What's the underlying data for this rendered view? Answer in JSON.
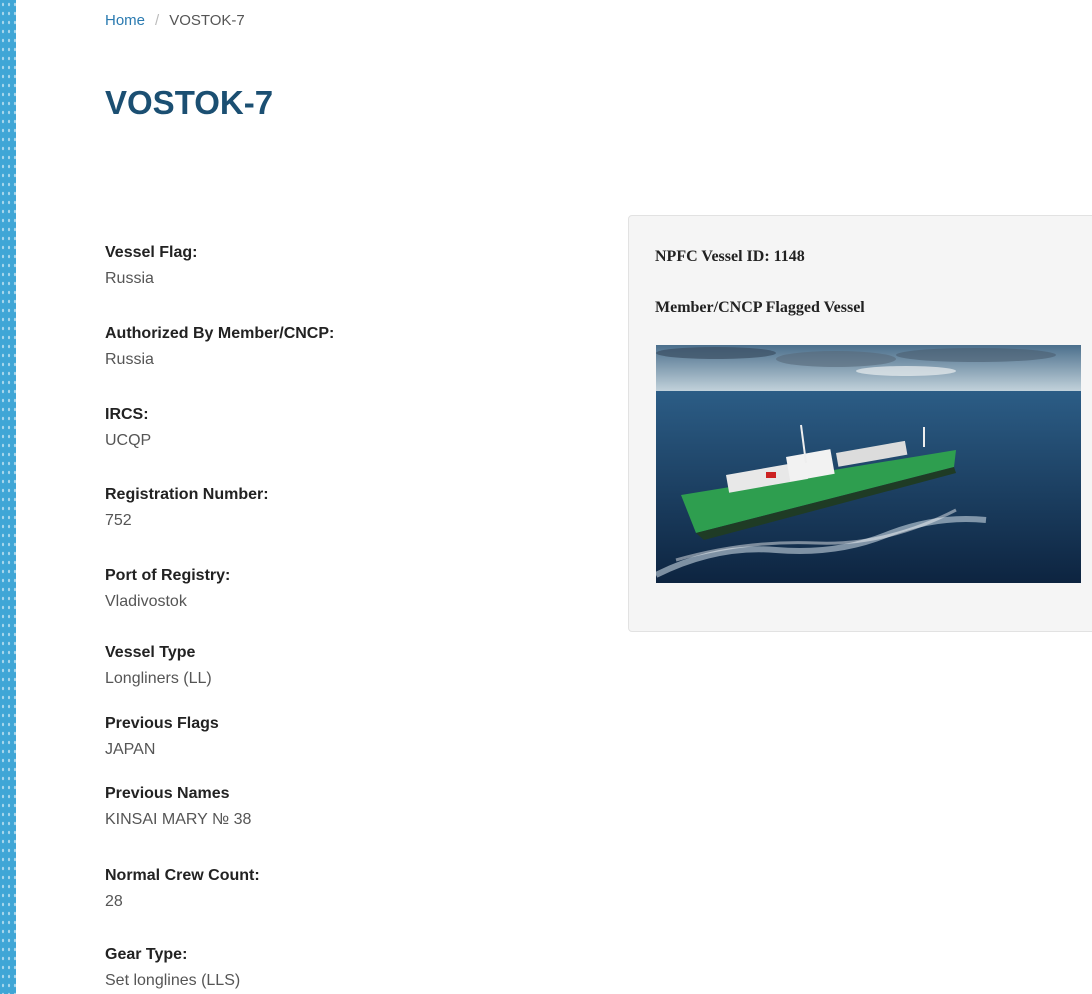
{
  "breadcrumb": {
    "home": "Home",
    "separator": "/",
    "current": "VOSTOK-7"
  },
  "page": {
    "title": "VOSTOK-7"
  },
  "fields": [
    {
      "label": "Vessel Flag:",
      "value": "Russia"
    },
    {
      "label": "Authorized By Member/CNCP:",
      "value": "Russia"
    },
    {
      "label": "IRCS:",
      "value": "UCQP"
    },
    {
      "label": "Registration Number:",
      "value": "752"
    },
    {
      "label": "Port of Registry:",
      "value": "Vladivostok"
    },
    {
      "label": "Vessel Type",
      "value": "Longliners (LL)"
    },
    {
      "label": "Previous Flags",
      "value": "JAPAN"
    },
    {
      "label": "Previous Names",
      "value": "KINSAI MARY № 38"
    },
    {
      "label": "Normal Crew Count:",
      "value": "28"
    },
    {
      "label": "Gear Type:",
      "value": "Set longlines (LLS)"
    }
  ],
  "card": {
    "vessel_id": "NPFC Vessel ID: 1148",
    "category": "Member/CNCP Flagged Vessel",
    "photo": "vessel-photo"
  },
  "colors": {
    "title": "#1b4f72",
    "link": "#2a7ab0",
    "strip": "#3fa6d6",
    "hull": "#2e9e4f"
  }
}
